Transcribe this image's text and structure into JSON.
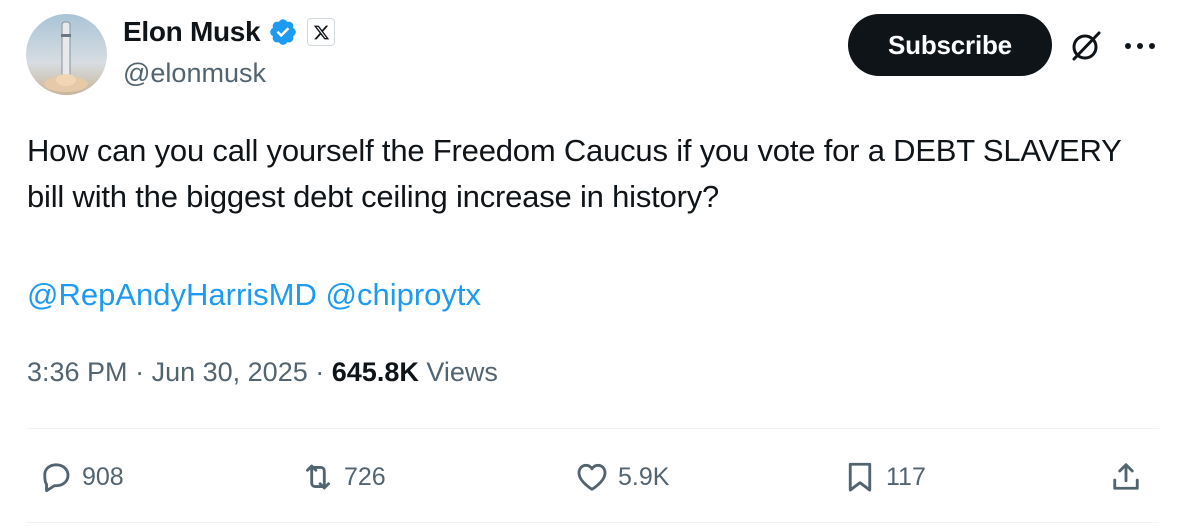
{
  "author": {
    "name": "Elon Musk",
    "handle": "@elonmusk",
    "verified_badge_color": "#1d9bf0"
  },
  "header_actions": {
    "subscribe_label": "Subscribe",
    "grok_icon": "grok-icon",
    "more_icon": "more-icon"
  },
  "tweet": {
    "text": "How can you call yourself the Freedom Caucus if you vote for a DEBT SLAVERY bill with the biggest debt ceiling increase in history?",
    "mentions": [
      "@RepAndyHarrisMD",
      "@chiproytx"
    ],
    "time": "3:36 PM",
    "separator": "·",
    "date": "Jun 30, 2025",
    "views_count": "645.8K",
    "views_label": "Views"
  },
  "actions": {
    "replies": "908",
    "reposts": "726",
    "likes": "5.9K",
    "bookmarks": "117"
  },
  "colors": {
    "link": "#1d9bf0",
    "text_primary": "#0f1419",
    "text_secondary": "#536471",
    "button_bg": "#0f1419"
  }
}
